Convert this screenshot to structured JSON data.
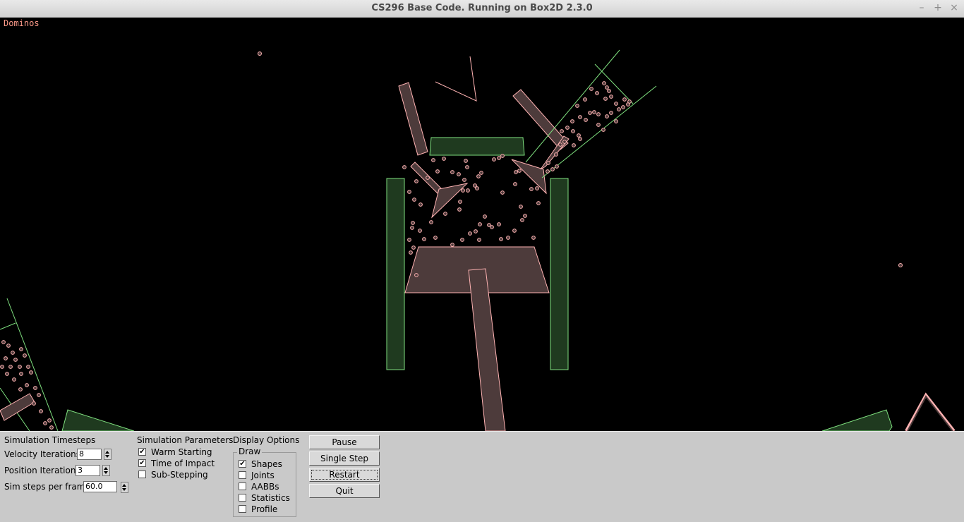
{
  "window": {
    "title": "CS296 Base Code. Running on Box2D 2.3.0",
    "minimize_glyph": "–",
    "maximize_glyph": "+",
    "close_glyph": "×"
  },
  "canvas": {
    "test_name": "Dominos"
  },
  "colors": {
    "static_outline": "#7fe07f",
    "static_fill": "#1f3a1f",
    "dynamic_outline": "#ffb3b3",
    "dynamic_fill": "#4d3b3b",
    "canvas_bg": "#000000"
  },
  "panel": {
    "timesteps": {
      "heading": "Simulation Timesteps",
      "velocity_label": "Velocity Iterations",
      "velocity_value": "8",
      "position_label": "Position Iterations",
      "position_value": "3",
      "sim_steps_label": "Sim steps per frame",
      "sim_steps_value": "60.0"
    },
    "params": {
      "heading": "Simulation Parameters",
      "items": [
        {
          "label": "Warm Starting",
          "checked": true
        },
        {
          "label": "Time of Impact",
          "checked": true
        },
        {
          "label": "Sub-Stepping",
          "checked": false
        }
      ]
    },
    "display": {
      "heading": "Display Options",
      "group_label": "Draw",
      "items": [
        {
          "label": "Shapes",
          "checked": true
        },
        {
          "label": "Joints",
          "checked": false
        },
        {
          "label": "AABBs",
          "checked": false
        },
        {
          "label": "Statistics",
          "checked": false
        },
        {
          "label": "Profile",
          "checked": false
        }
      ]
    },
    "buttons": {
      "pause": "Pause",
      "single_step": "Single Step",
      "restart": "Restart",
      "quit": "Quit"
    }
  }
}
